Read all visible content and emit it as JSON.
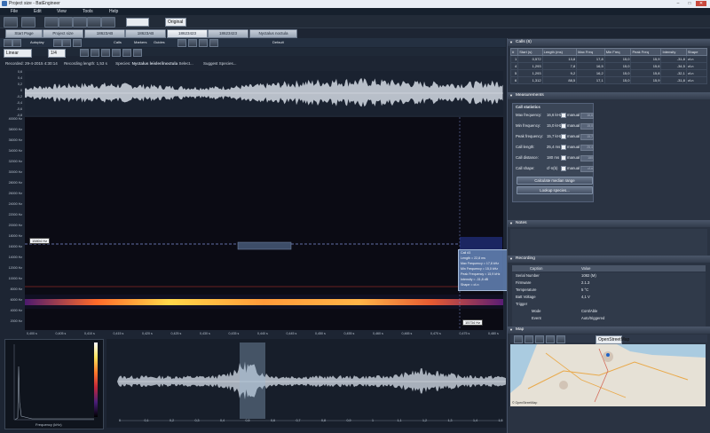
{
  "window": {
    "title": "Project size - BatEngineer",
    "min": "–",
    "max": "□",
    "close": "✕"
  },
  "menu": [
    "File",
    "Edit",
    "View",
    "Tools",
    "Help"
  ],
  "toolbar": {
    "zoom_value": "Original"
  },
  "tabs": [
    {
      "label": "Start Page",
      "active": false
    },
    {
      "label": "Project size",
      "active": false
    },
    {
      "label": "18623AB",
      "active": false
    },
    {
      "label": "18623AB",
      "active": false
    },
    {
      "label": "18623423",
      "active": true
    },
    {
      "label": "18623423",
      "active": false
    },
    {
      "label": "Nyctalus noctula",
      "active": false
    }
  ],
  "toolrow": {
    "autoplay": "Autoplay",
    "calls": "Calls",
    "markers": "Markers",
    "guides": "Guides",
    "preset": "Default",
    "linear": "Linear",
    "rate": "1/4"
  },
  "recording_info": {
    "recorded": "Recorded: 29-4-2015 4:30:14",
    "length": "Recording length: 1,53 s",
    "species_label": "Species:",
    "species": "Nyctalus leisleri/noctula",
    "species_select": "Select...",
    "suggest": "Suggest Species..."
  },
  "wave_axis": [
    "0,6",
    "0,4",
    "0,2",
    "0",
    "-0,2",
    "-0,4",
    "-0,6",
    "-0,8"
  ],
  "spec_axis": [
    "40000 Hz",
    "38000 Hz",
    "36000 Hz",
    "34000 Hz",
    "32000 Hz",
    "30000 Hz",
    "28000 Hz",
    "26000 Hz",
    "24000 Hz",
    "22000 Hz",
    "20000 Hz",
    "18000 Hz",
    "16000 Hz",
    "14000 Hz",
    "12000 Hz",
    "10000 Hz",
    "8000 Hz",
    "6000 Hz",
    "4000 Hz",
    "2000 Hz"
  ],
  "spec_xaxis": [
    "0,400 s",
    "0,405 s",
    "0,410 s",
    "0,415 s",
    "0,420 s",
    "0,425 s",
    "0,430 s",
    "0,435 s",
    "0,440 s",
    "0,445 s",
    "0,450 s",
    "0,455 s",
    "0,460 s",
    "0,465 s",
    "0,470 s",
    "0,475 s",
    "0,480 s"
  ],
  "hz_labels": {
    "left": "15804 Hz",
    "right": "15734 Hz"
  },
  "call_tooltip": [
    "Call #3",
    "Length = 22,8 ms",
    "Max Frequency = 17,8 kHz",
    "Min Frequency = 15,0 kHz",
    "Peak Frequency = 15,9 kHz",
    "Intensity = -31,8 dB",
    "Shape = cf-n"
  ],
  "cells": {
    "title": "Calls (6)",
    "headers": [
      "#",
      "Start (s)",
      "Length (ms)",
      "Max Freq",
      "Min Freq",
      "Peak Freq",
      "Intensity",
      "Shape"
    ],
    "rows": [
      [
        "1",
        "0,572",
        "13,8",
        "17,8",
        "15,0",
        "15,9",
        "-31,8",
        "cf-n"
      ],
      [
        "4",
        "1,293",
        "7,8",
        "16,5",
        "15,0",
        "15,6",
        "-34,5",
        "cf-n"
      ],
      [
        "5",
        "1,293",
        "9,2",
        "16,2",
        "15,0",
        "15,8",
        "-32,1",
        "cf-n"
      ],
      [
        "6",
        "1,312",
        "88,5",
        "17,1",
        "15,0",
        "15,9",
        "-31,8",
        "cf-n"
      ]
    ]
  },
  "measurements": {
    "title": "Measurements",
    "box_title": "Call statistics",
    "rows": [
      {
        "label": "Max frequency:",
        "value": "16,6 kHz",
        "manual": "manual",
        "box": "16,6"
      },
      {
        "label": "Min frequency:",
        "value": "15,0 kHz",
        "manual": "manual",
        "box": "15,0"
      },
      {
        "label": "Peak frequency:",
        "value": "15,7 kHz",
        "manual": "manual",
        "box": "15,7"
      },
      {
        "label": "Call length:",
        "value": "25,4 ms",
        "manual": "manual",
        "box": "25,4"
      },
      {
        "label": "Call distance:",
        "value": "180 ms",
        "manual": "manual",
        "box": "180"
      },
      {
        "label": "Call shape:",
        "value": "cf-n(b)",
        "manual": "manual",
        "box": "cf-n"
      }
    ],
    "calc_btn": "Calculate median range",
    "lookup_btn": "Lookup species..."
  },
  "notes": {
    "title": "Notes"
  },
  "recording": {
    "title": "Recording",
    "headers": [
      "Caption",
      "Value"
    ],
    "rows": [
      [
        "Serial Number",
        "1082 (M)"
      ],
      [
        "Firmware",
        "2.1.3"
      ],
      [
        "Temperature",
        "5 °C"
      ],
      [
        "Batt Voltage",
        "4,1 V"
      ],
      [
        "Trigger",
        ""
      ],
      [
        "Mode",
        "Cont/Able"
      ],
      [
        "Event",
        "Auto/triggered"
      ]
    ]
  },
  "map": {
    "title": "Map",
    "layer": "OpenStreetMap",
    "attribution": "© OpenStreetMap"
  },
  "bottom": {
    "freq_label": "Frequency (kHz)",
    "x_ticks": [
      "0",
      "0,1",
      "0,2",
      "0,3",
      "0,4",
      "0,5",
      "0,6",
      "0,7",
      "0,8",
      "0,9",
      "1",
      "1,1",
      "1,2",
      "1,3",
      "1,4",
      "1,5"
    ]
  }
}
